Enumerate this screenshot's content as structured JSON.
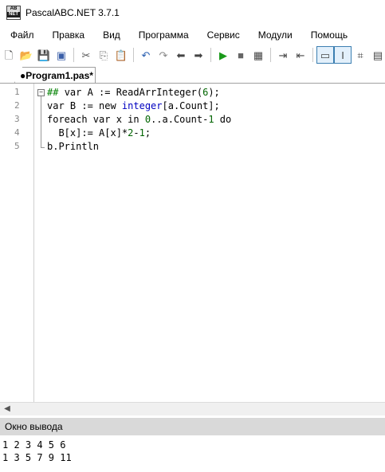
{
  "window": {
    "title": "PascalABC.NET 3.7.1",
    "icon_top": "AB",
    "icon_bottom": "NET"
  },
  "menu": [
    "Файл",
    "Правка",
    "Вид",
    "Программа",
    "Сервис",
    "Модули",
    "Помощь"
  ],
  "toolbar": {
    "buttons": [
      {
        "icon": "new-file-icon",
        "glyph": "🗋"
      },
      {
        "icon": "open-folder-icon",
        "glyph": "📂"
      },
      {
        "icon": "save-icon",
        "glyph": "💾"
      },
      {
        "icon": "save-all-icon",
        "glyph": "▣"
      },
      {
        "icon": "cut-icon",
        "glyph": "✂"
      },
      {
        "icon": "copy-icon",
        "glyph": "⎘"
      },
      {
        "icon": "paste-icon",
        "glyph": "📋"
      },
      {
        "icon": "undo-icon",
        "glyph": "↶"
      },
      {
        "icon": "redo-icon",
        "glyph": "↷"
      },
      {
        "icon": "navigate-back-icon",
        "glyph": "⬅"
      },
      {
        "icon": "navigate-forward-icon",
        "glyph": "➡"
      },
      {
        "icon": "run-icon",
        "glyph": "▶"
      },
      {
        "icon": "stop-icon",
        "glyph": "■"
      },
      {
        "icon": "compile-icon",
        "glyph": "▦"
      },
      {
        "icon": "debug-step-icon",
        "glyph": "⇥"
      },
      {
        "icon": "debug-step-over-icon",
        "glyph": "⇤"
      },
      {
        "icon": "show-output-icon",
        "glyph": "▭"
      },
      {
        "icon": "show-debug-icon",
        "glyph": "I"
      },
      {
        "icon": "format-code-icon",
        "glyph": "⌗"
      },
      {
        "icon": "extra-icon",
        "glyph": "▤"
      }
    ]
  },
  "tab": {
    "label": "●Program1.pas*"
  },
  "editor": {
    "line_numbers": [
      "1",
      "2",
      "3",
      "4",
      "5"
    ],
    "lines": [
      [
        {
          "t": "## ",
          "c": "dir"
        },
        {
          "t": "var A := ReadArrInteger(",
          "c": "kw"
        },
        {
          "t": "6",
          "c": "num"
        },
        {
          "t": ");",
          "c": "kw"
        }
      ],
      [
        {
          "t": "var B := new ",
          "c": "kw"
        },
        {
          "t": "integer",
          "c": "type"
        },
        {
          "t": "[a.Count];",
          "c": "kw"
        }
      ],
      [
        {
          "t": "foreach var x in ",
          "c": "kw"
        },
        {
          "t": "0",
          "c": "num"
        },
        {
          "t": "..a.Count-",
          "c": "kw"
        },
        {
          "t": "1",
          "c": "num"
        },
        {
          "t": " do",
          "c": "kw"
        }
      ],
      [
        {
          "t": "  B[x]:= A[x]*",
          "c": "kw"
        },
        {
          "t": "2",
          "c": "num"
        },
        {
          "t": "-",
          "c": "kw"
        },
        {
          "t": "1",
          "c": "num"
        },
        {
          "t": ";",
          "c": "kw"
        }
      ],
      [
        {
          "t": "b.Println",
          "c": "kw"
        }
      ]
    ]
  },
  "output": {
    "title": "Окно вывода",
    "lines": [
      "1 2 3 4 5 6",
      "1 3 5 7 9 11"
    ]
  }
}
